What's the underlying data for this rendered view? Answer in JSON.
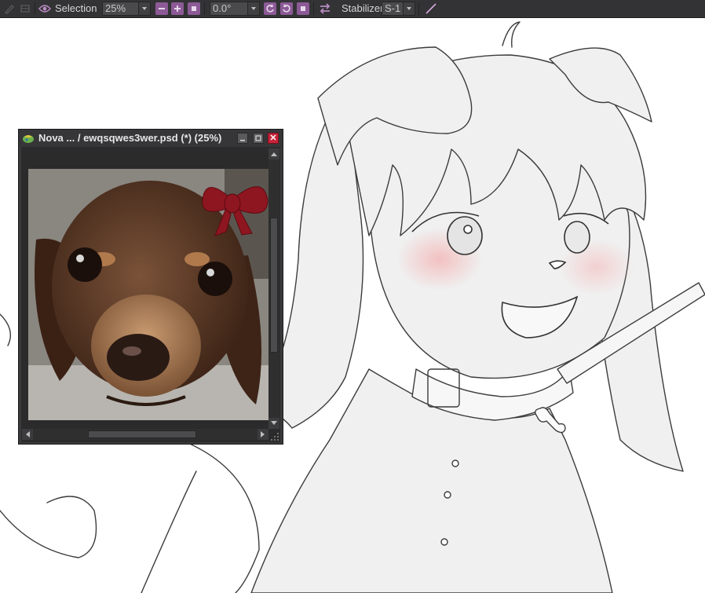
{
  "toolbar": {
    "view_mode_label": "Selection",
    "zoom_value": "25%",
    "rotation_value": "0.0°",
    "stabilizer_label": "Stabilizer",
    "stabilizer_value": "S-1"
  },
  "navigator": {
    "title": "Nova ... / ewqsqwes3wer.psd (*) (25%)",
    "close_glyph": "✕"
  },
  "colors": {
    "toolbar_bg": "#333335",
    "accent_purple": "#8c5a96",
    "close_red": "#c8243a",
    "bow_red": "#8e1620"
  },
  "icons": [
    "brush-icon",
    "eye-icon",
    "zoom-out-icon",
    "zoom-in-icon",
    "fit-icon",
    "rotate-left-icon",
    "rotate-right-icon",
    "reset-rotation-icon",
    "flip-icon",
    "line-tool-icon",
    "app-icon",
    "minimize-icon",
    "maximize-icon",
    "close-icon"
  ]
}
